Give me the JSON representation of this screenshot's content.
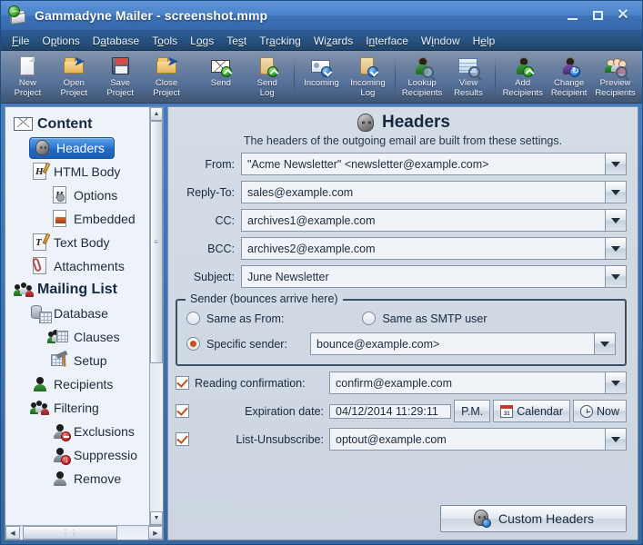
{
  "window": {
    "title": "Gammadyne Mailer - screenshot.mmp",
    "app_icon": "mail-stack-globe-icon",
    "controls": [
      {
        "name": "minimize-button",
        "glyph": "_"
      },
      {
        "name": "maximize-button",
        "glyph": "□"
      },
      {
        "name": "close-button",
        "glyph": "✕"
      }
    ]
  },
  "menubar": {
    "items": [
      {
        "label": "File",
        "accel_index": 0
      },
      {
        "label": "Options",
        "accel_index": 1
      },
      {
        "label": "Database",
        "accel_index": 1
      },
      {
        "label": "Tools",
        "accel_index": 1
      },
      {
        "label": "Logs",
        "accel_index": 1
      },
      {
        "label": "Test",
        "accel_index": 2
      },
      {
        "label": "Tracking",
        "accel_index": 2
      },
      {
        "label": "Wizards",
        "accel_index": 2
      },
      {
        "label": "Interface",
        "accel_index": 1
      },
      {
        "label": "Window",
        "accel_index": 1
      },
      {
        "label": "Help",
        "accel_index": 1
      }
    ]
  },
  "toolbar": {
    "buttons": [
      {
        "line1": "New",
        "line2": "Project",
        "icon": "new-document-icon"
      },
      {
        "line1": "Open",
        "line2": "Project",
        "icon": "open-folder-icon"
      },
      {
        "line1": "Save",
        "line2": "Project",
        "icon": "floppy-disk-icon"
      },
      {
        "line1": "Close",
        "line2": "Project",
        "icon": "close-folder-icon"
      },
      {
        "line1": "Send",
        "line2": "",
        "icon": "send-envelope-icon"
      },
      {
        "line1": "Send",
        "line2": "Log",
        "icon": "send-log-scroll-icon"
      },
      {
        "line1": "Incoming",
        "line2": "",
        "icon": "incoming-card-icon"
      },
      {
        "line1": "Incoming",
        "line2": "Log",
        "icon": "incoming-log-scroll-icon"
      },
      {
        "line1": "Lookup",
        "line2": "Recipients",
        "icon": "lookup-person-magnifier-icon"
      },
      {
        "line1": "View",
        "line2": "Results",
        "icon": "view-results-grid-magnifier-icon"
      },
      {
        "line1": "Add",
        "line2": "Recipients",
        "icon": "add-person-icon"
      },
      {
        "line1": "Change",
        "line2": "Recipient",
        "icon": "change-person-icon"
      },
      {
        "line1": "Preview",
        "line2": "Recipients",
        "icon": "preview-people-magnifier-icon"
      }
    ],
    "separators_after": [
      3,
      5,
      7,
      9
    ]
  },
  "sidebar": {
    "selected": "Headers",
    "items": [
      {
        "label": "Content",
        "indent": 0,
        "type": "group",
        "icon": "open-envelope-icon"
      },
      {
        "label": "Headers",
        "indent": 1,
        "type": "item",
        "icon": "head-profile-icon",
        "selected": true
      },
      {
        "label": "HTML Body",
        "indent": 1,
        "type": "item",
        "icon": "html-document-icon"
      },
      {
        "label": "Options",
        "indent": 2,
        "type": "item",
        "icon": "html-options-gear-icon"
      },
      {
        "label": "Embedded",
        "indent": 2,
        "type": "item",
        "icon": "embedded-image-icon"
      },
      {
        "label": "Text Body",
        "indent": 1,
        "type": "item",
        "icon": "text-document-icon"
      },
      {
        "label": "Attachments",
        "indent": 1,
        "type": "item",
        "icon": "paperclip-document-icon"
      },
      {
        "label": "Mailing List",
        "indent": 0,
        "type": "group",
        "icon": "people-group-icon"
      },
      {
        "label": "Database",
        "indent": 1,
        "type": "item",
        "icon": "database-table-icon"
      },
      {
        "label": "Clauses",
        "indent": 2,
        "type": "item",
        "icon": "clauses-table-icon"
      },
      {
        "label": "Setup",
        "indent": 2,
        "type": "item",
        "icon": "setup-hammer-icon"
      },
      {
        "label": "Recipients",
        "indent": 1,
        "type": "item",
        "icon": "recipient-person-icon"
      },
      {
        "label": "Filtering",
        "indent": 1,
        "type": "item",
        "icon": "filtering-people-icon"
      },
      {
        "label": "Exclusions",
        "indent": 2,
        "type": "item",
        "icon": "exclusion-person-deny-icon"
      },
      {
        "label": "Suppressio",
        "indent": 2,
        "type": "item",
        "icon": "suppression-person-down-icon"
      },
      {
        "label": "Remove",
        "indent": 2,
        "type": "item",
        "icon": "remove-person-icon"
      }
    ]
  },
  "panel": {
    "title": "Headers",
    "title_icon": "head-profile-icon",
    "subtitle": "The headers of the outgoing email are built from these settings.",
    "fields": [
      {
        "label": "From:",
        "value": "\"Acme Newsletter\" <newsletter@example.com>"
      },
      {
        "label": "Reply-To:",
        "value": "sales@example.com"
      },
      {
        "label": "CC:",
        "value": "archives1@example.com"
      },
      {
        "label": "BCC:",
        "value": "archives2@example.com"
      },
      {
        "label": "Subject:",
        "value": "June Newsletter"
      }
    ],
    "sender_group": {
      "title": "Sender (bounces arrive here)",
      "options": [
        {
          "label": "Same as From:",
          "selected": false
        },
        {
          "label": "Same as SMTP user",
          "selected": false
        },
        {
          "label": "Specific sender:",
          "selected": true
        }
      ],
      "specific_value": "bounce@example.com>"
    },
    "options": [
      {
        "label": "Reading confirmation:",
        "checked": true,
        "value": "confirm@example.com",
        "kind": "combo"
      },
      {
        "label": "Expiration date:",
        "checked": true,
        "value": "04/12/2014 11:29:11",
        "kind": "date",
        "buttons": [
          {
            "label": "P.M.",
            "icon": ""
          },
          {
            "label": "Calendar",
            "icon": "calendar-icon"
          },
          {
            "label": "Now",
            "icon": "clock-icon"
          }
        ]
      },
      {
        "label": "List-Unsubscribe:",
        "checked": true,
        "value": "optout@example.com",
        "kind": "combo"
      }
    ],
    "custom_headers_button": {
      "label": "Custom Headers",
      "icon": "head-profile-badge-icon"
    }
  },
  "colors": {
    "title_bar": "#4b83c9",
    "menu_bar": "#27517f",
    "toolbar": "#6c81a0",
    "panel_bg": "#d0d9e4",
    "selection": "#2f7ad4",
    "accent_check": "#c4511a"
  }
}
